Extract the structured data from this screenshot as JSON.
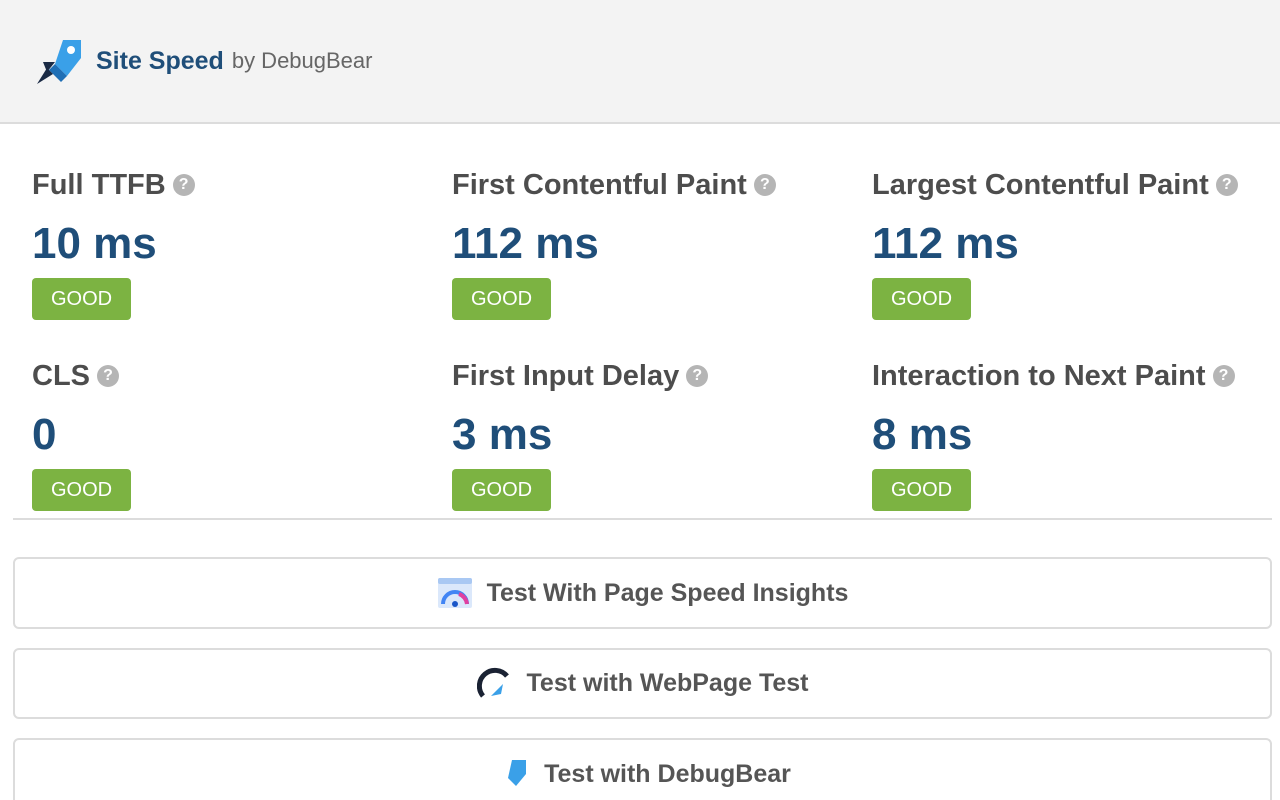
{
  "header": {
    "brand_name": "Site Speed",
    "brand_by": "by DebugBear",
    "logo_icon": "rocket-logo-icon"
  },
  "metrics": [
    {
      "title": "Full TTFB",
      "value": "10 ms",
      "status": "GOOD"
    },
    {
      "title": "First Contentful Paint",
      "value": "112 ms",
      "status": "GOOD"
    },
    {
      "title": "Largest Contentful Paint",
      "value": "112 ms",
      "status": "GOOD"
    },
    {
      "title": "CLS",
      "value": "0",
      "status": "GOOD"
    },
    {
      "title": "First Input Delay",
      "value": "3 ms",
      "status": "GOOD"
    },
    {
      "title": "Interaction to Next Paint",
      "value": "8 ms",
      "status": "GOOD"
    }
  ],
  "help_symbol": "?",
  "actions": [
    {
      "label": "Test With Page Speed Insights",
      "icon": "pagespeed-insights-icon"
    },
    {
      "label": "Test with WebPage Test",
      "icon": "webpagetest-icon"
    },
    {
      "label": "Test with DebugBear",
      "icon": "debugbear-icon"
    }
  ],
  "colors": {
    "accent": "#1f4e79",
    "good": "#7cb342",
    "header_bg": "#f3f3f3"
  }
}
